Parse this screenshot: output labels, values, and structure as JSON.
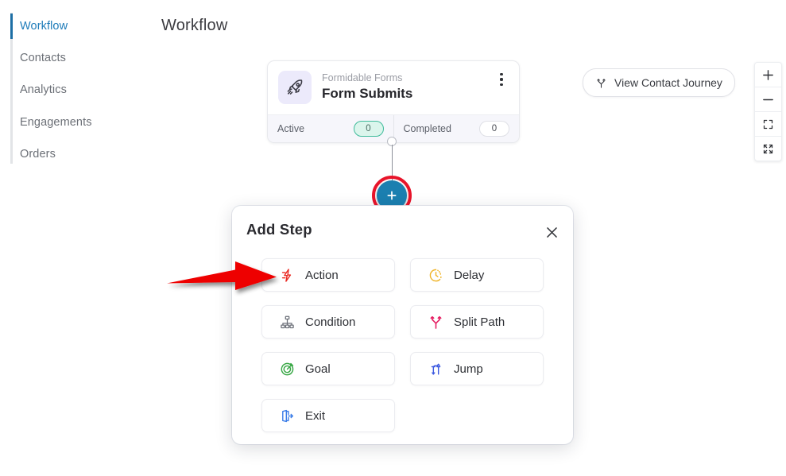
{
  "sidebar": {
    "items": [
      {
        "label": "Workflow",
        "active": true
      },
      {
        "label": "Contacts",
        "active": false
      },
      {
        "label": "Analytics",
        "active": false
      },
      {
        "label": "Engagements",
        "active": false
      },
      {
        "label": "Orders",
        "active": false
      }
    ],
    "active_indicator_color": "#1d6fa5"
  },
  "header": {
    "title": "Workflow"
  },
  "node_card": {
    "icon": "rocket-icon",
    "subtitle": "Formidable Forms",
    "title": "Form Submits",
    "menu_icon": "kebab-menu-icon",
    "stats": [
      {
        "label": "Active",
        "value": "0",
        "style": "active"
      },
      {
        "label": "Completed",
        "value": "0",
        "style": "completed"
      }
    ]
  },
  "canvas": {
    "add_node_icon": "plus-icon",
    "add_node_color": "#1b7fb0",
    "highlight_ring_color": "#e8142a",
    "annotation_arrow_color": "#ee0000"
  },
  "journey_button": {
    "icon": "split-path-icon",
    "label": "View Contact Journey"
  },
  "zoom_controls": {
    "buttons": [
      {
        "name": "zoom-in",
        "icon": "plus-icon"
      },
      {
        "name": "zoom-out",
        "icon": "minus-icon"
      },
      {
        "name": "fit-view",
        "icon": "fit-screen-icon"
      },
      {
        "name": "expand",
        "icon": "expand-arrows-icon"
      }
    ]
  },
  "add_step_panel": {
    "title": "Add Step",
    "close_icon": "close-icon",
    "options": [
      {
        "label": "Action",
        "icon": "lightning-bolt-icon",
        "color": "#ea2a23"
      },
      {
        "label": "Delay",
        "icon": "clock-icon",
        "color": "#f0b429"
      },
      {
        "label": "Condition",
        "icon": "hierarchy-icon",
        "color": "#6b6f78"
      },
      {
        "label": "Split Path",
        "icon": "split-path-icon",
        "color": "#e51e62"
      },
      {
        "label": "Goal",
        "icon": "target-icon",
        "color": "#37a744"
      },
      {
        "label": "Jump",
        "icon": "jump-icon",
        "color": "#3d5ae0"
      },
      {
        "label": "Exit",
        "icon": "exit-door-icon",
        "color": "#3d7ee8"
      }
    ]
  }
}
